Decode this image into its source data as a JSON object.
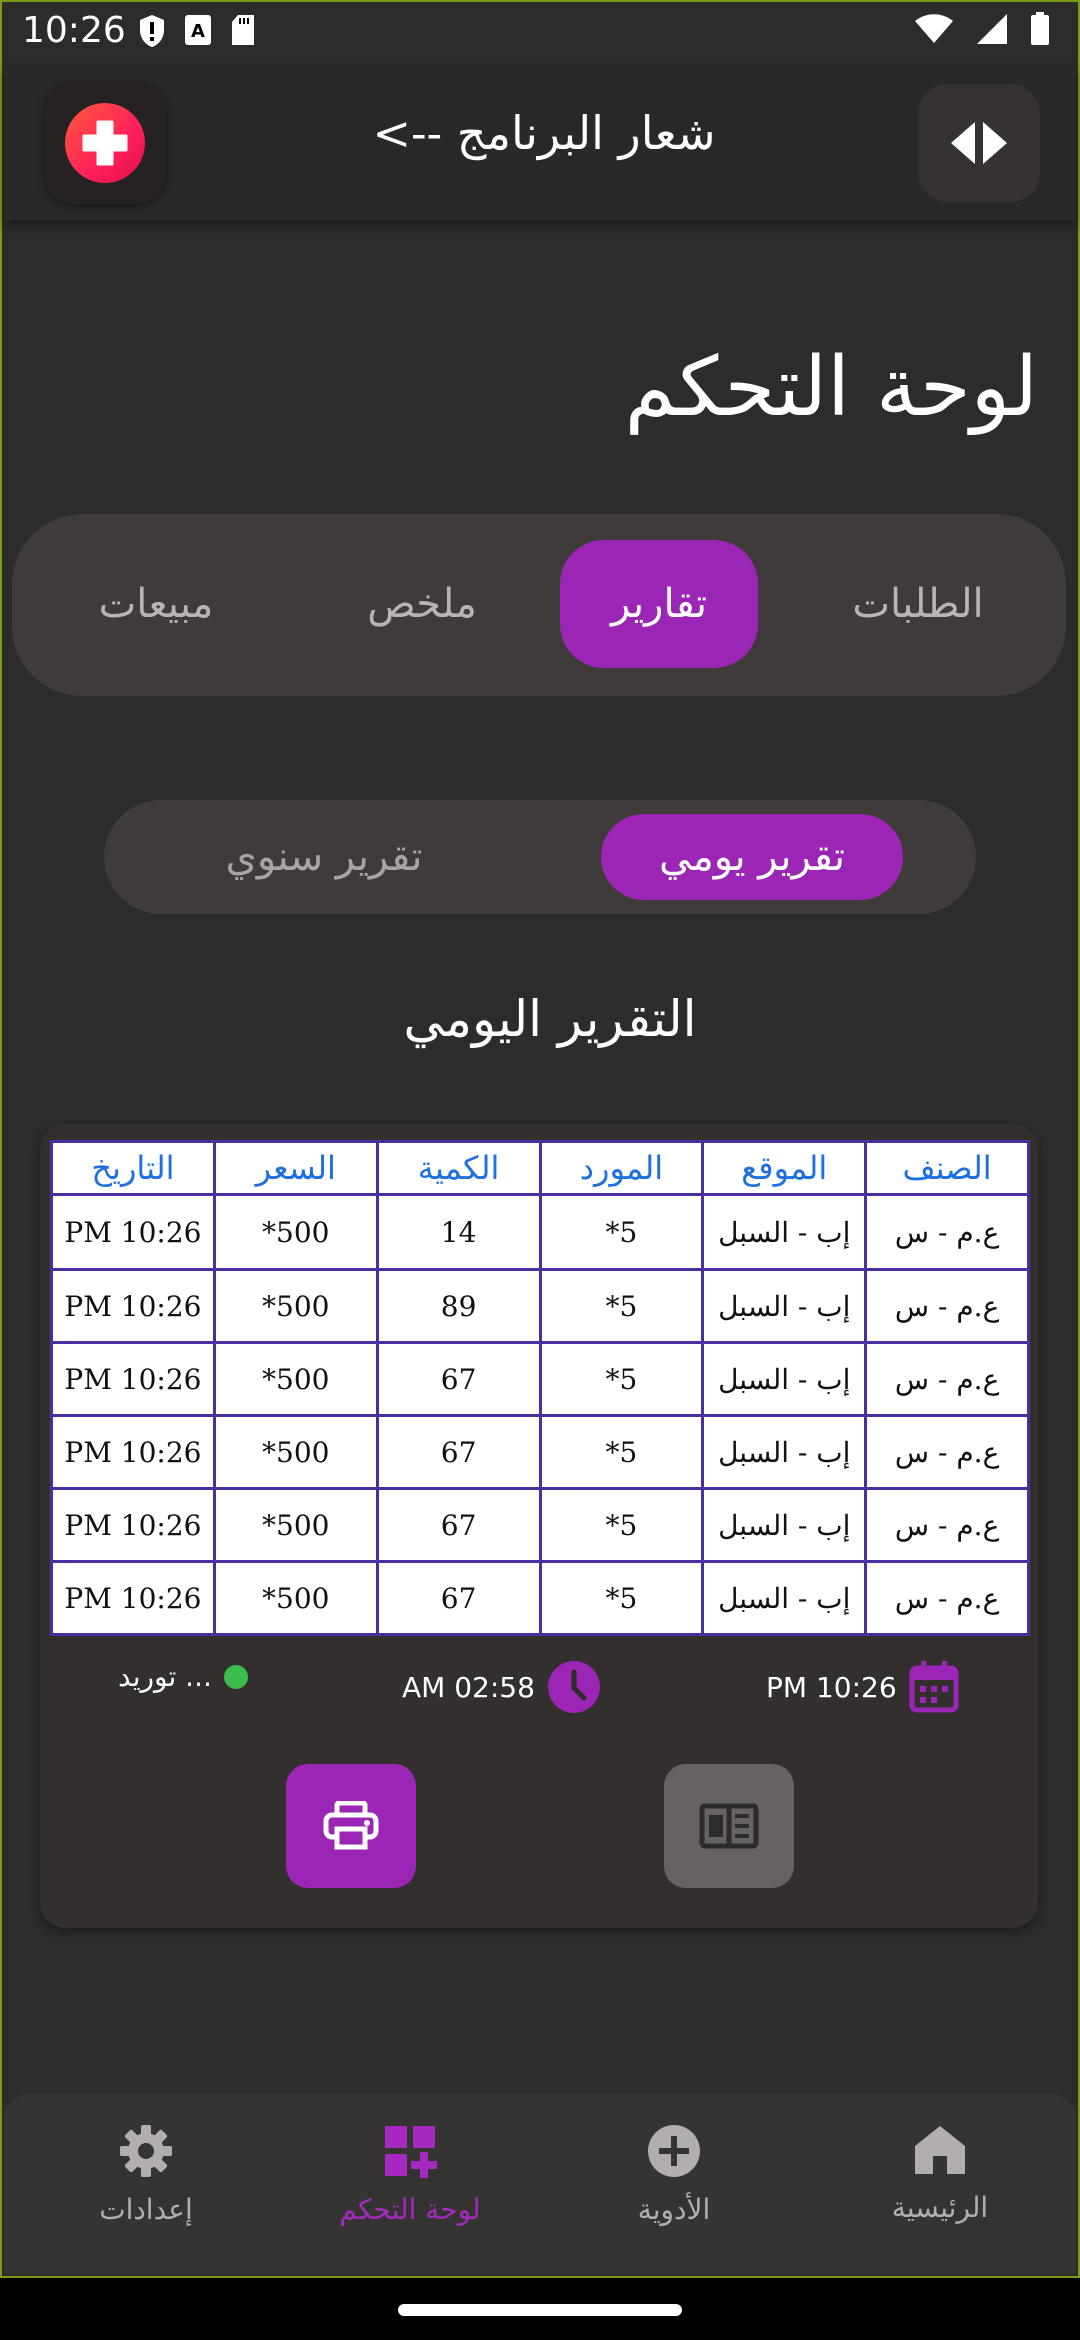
{
  "status_bar": {
    "time": "10:26"
  },
  "header": {
    "app_title": "شعار البرنامج -->"
  },
  "page": {
    "title": "لوحة التحكم"
  },
  "tabs": [
    {
      "label": "الطلبات",
      "active": false
    },
    {
      "label": "تقارير",
      "active": true
    },
    {
      "label": "ملخص",
      "active": false
    },
    {
      "label": "مبيعات",
      "active": false
    }
  ],
  "segment": {
    "daily": "تقرير يومي",
    "yearly": "تقرير سنوي"
  },
  "report": {
    "title": "التقرير اليومي",
    "columns": [
      "الصنف",
      "الموقع",
      "المورد",
      "الكمية",
      "السعر",
      "التاريخ"
    ],
    "rows": [
      [
        "ع.م - س",
        "إب - السبل",
        "5*",
        "14",
        "500*",
        "PM 10:26"
      ],
      [
        "ع.م - س",
        "إب - السبل",
        "5*",
        "89",
        "500*",
        "PM 10:26"
      ],
      [
        "ع.م - س",
        "إب - السبل",
        "5*",
        "67",
        "500*",
        "PM 10:26"
      ],
      [
        "ع.م - س",
        "إب - السبل",
        "5*",
        "67",
        "500*",
        "PM 10:26"
      ],
      [
        "ع.م - س",
        "إب - السبل",
        "5*",
        "67",
        "500*",
        "PM 10:26"
      ],
      [
        "ع.م - س",
        "إب - السبل",
        "5*",
        "67",
        "500*",
        "PM 10:26"
      ]
    ],
    "footer": {
      "date": "PM 10:26",
      "time": "AM 02:58",
      "status": "توريد ..."
    }
  },
  "bottom_nav": [
    {
      "label": "الرئيسية",
      "icon": "home-icon",
      "active": false
    },
    {
      "label": "الأدوية",
      "icon": "add-circle-icon",
      "active": false
    },
    {
      "label": "لوحة التحكم",
      "icon": "dashboard-icon",
      "active": true
    },
    {
      "label": "إعدادات",
      "icon": "gear-icon",
      "active": false
    }
  ],
  "colors": {
    "accent": "#9b26b6",
    "background": "#2e2b2b",
    "table_header": "#1e6fe0",
    "table_border": "#4b2ea0",
    "status_dot": "#3cbc4c"
  }
}
